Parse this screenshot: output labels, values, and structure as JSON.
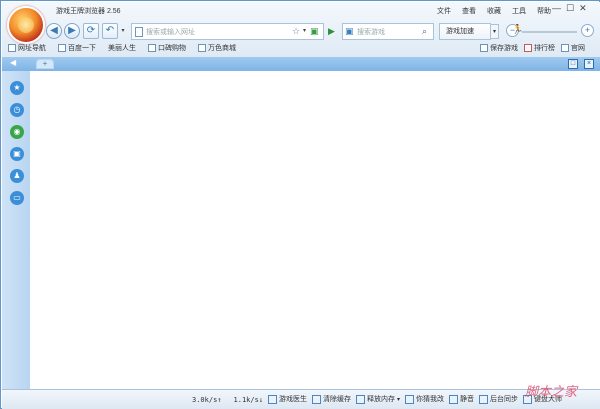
{
  "app": {
    "title": "游戏王牌浏览器 2.56"
  },
  "menu": [
    "文件",
    "查看",
    "收藏",
    "工具",
    "帮助"
  ],
  "window_controls": {
    "min": "—",
    "max": "☐",
    "close": "✕"
  },
  "address": {
    "placeholder": "搜索或输入网址"
  },
  "search": {
    "placeholder": "搜索游戏"
  },
  "game_accelerate": {
    "label": "游戏加速"
  },
  "bookmarks": [
    "网址导航",
    "百度一下",
    "美丽人生",
    "口碑购物",
    "万色商城"
  ],
  "right_bookmarks": [
    "保存游戏",
    "排行榜",
    "官网"
  ],
  "status": {
    "down": "3.0k/s↑",
    "up": "1.1k/s↓"
  },
  "tools": [
    "游戏医生",
    "清除缓存",
    "释放内存",
    "你猜我改",
    "静音",
    "后台同步",
    "键盘大师"
  ],
  "watermark": "脚本之家"
}
